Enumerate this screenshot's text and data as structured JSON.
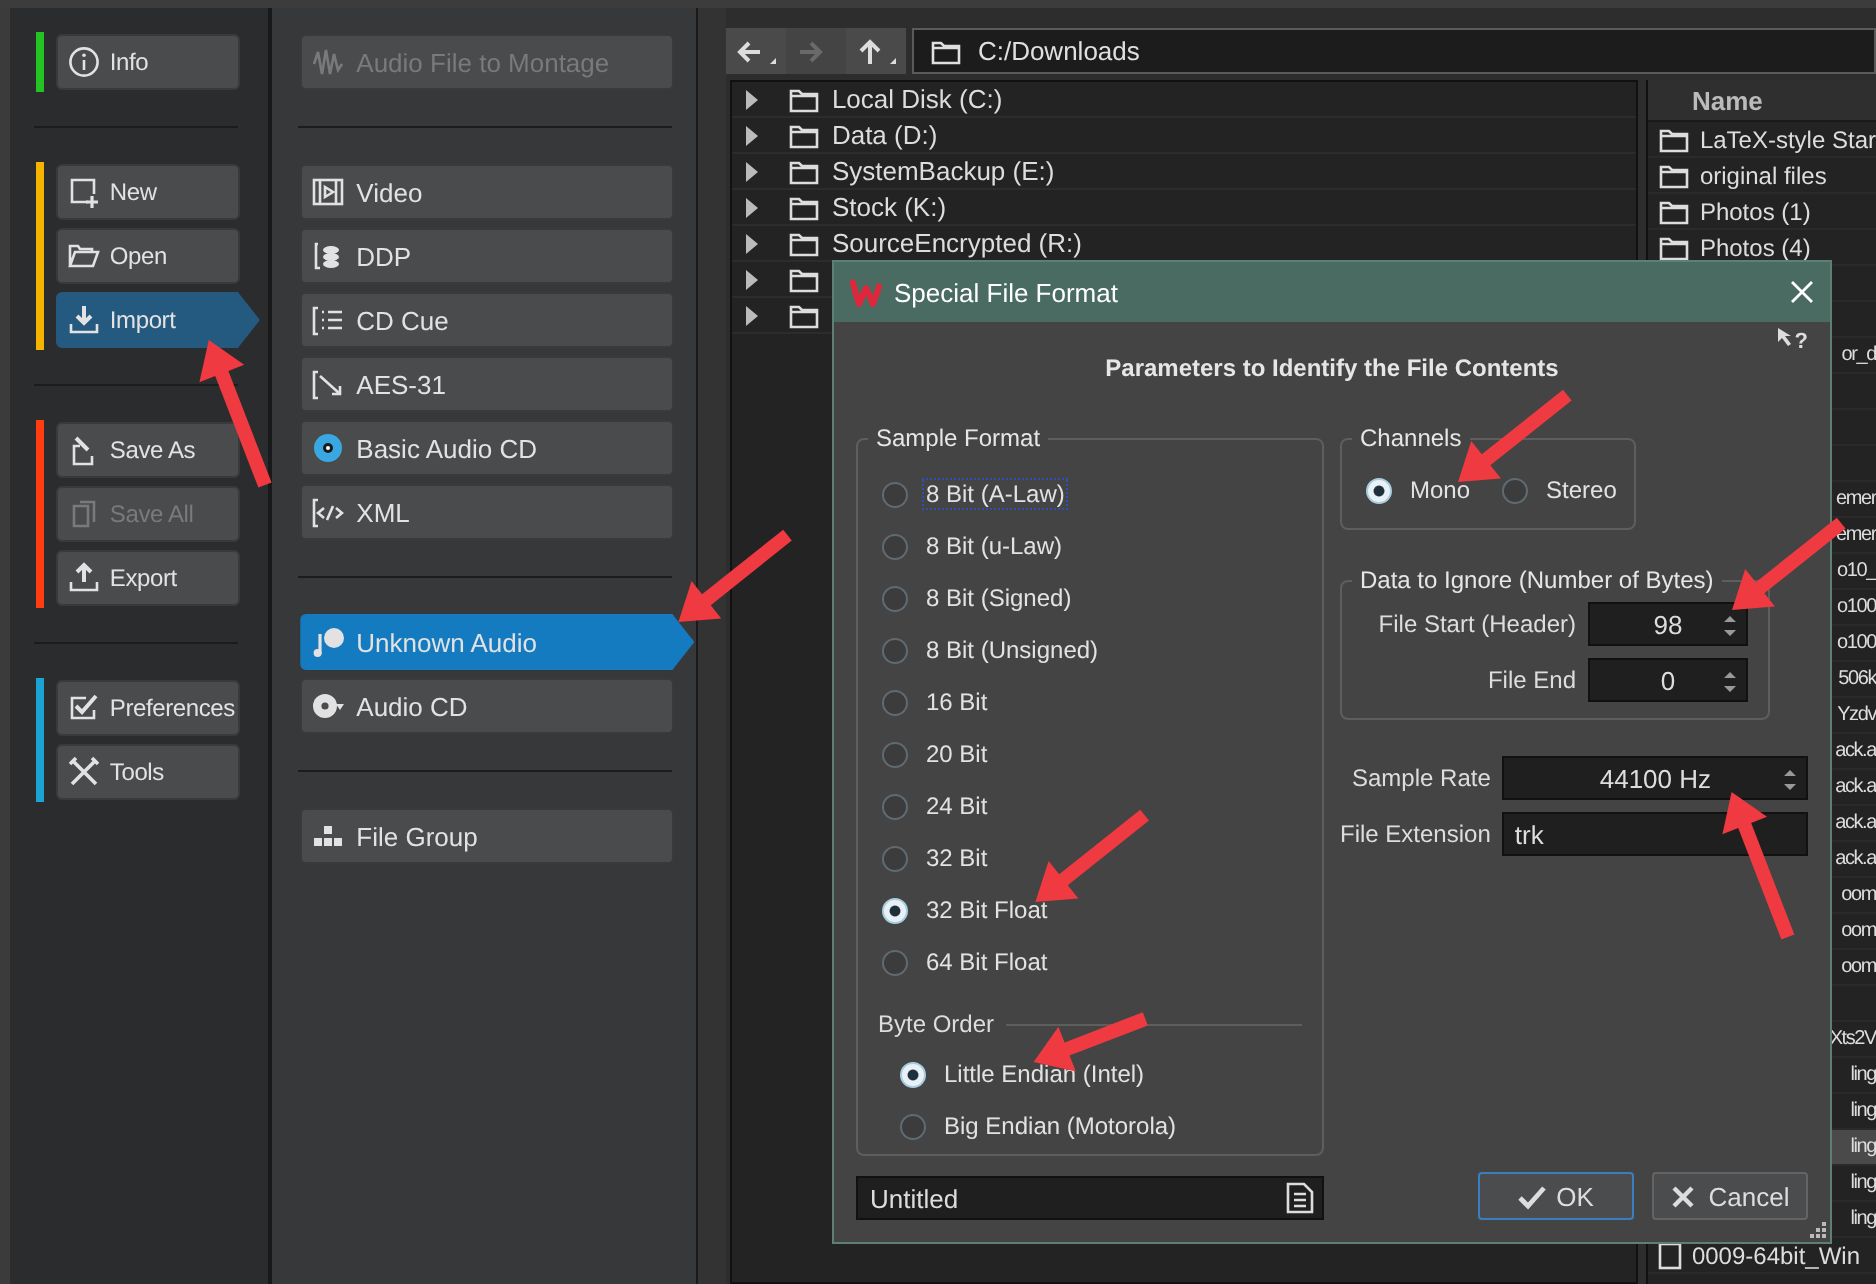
{
  "sidebar": {
    "groups": [
      {
        "color": "#22c322",
        "items": [
          {
            "label": "Info",
            "selected": false,
            "disabled": false
          }
        ]
      },
      {
        "color": "#f5b400",
        "items": [
          {
            "label": "New",
            "selected": false,
            "disabled": false
          },
          {
            "label": "Open",
            "selected": false,
            "disabled": false
          },
          {
            "label": "Import",
            "selected": true,
            "disabled": false
          }
        ]
      },
      {
        "color": "#ff3d10",
        "items": [
          {
            "label": "Save As",
            "selected": false,
            "disabled": false
          },
          {
            "label": "Save All",
            "selected": false,
            "disabled": true
          },
          {
            "label": "Export",
            "selected": false,
            "disabled": false
          }
        ]
      },
      {
        "color": "#1aa3d4",
        "items": [
          {
            "label": "Preferences",
            "selected": false,
            "disabled": false
          },
          {
            "label": "Tools",
            "selected": false,
            "disabled": false
          }
        ]
      }
    ]
  },
  "format_panel": {
    "groups": [
      {
        "items": [
          {
            "label": "Audio File to Montage",
            "selected": false,
            "disabled": true
          }
        ]
      },
      {
        "items": [
          {
            "label": "Video",
            "selected": false,
            "disabled": false
          },
          {
            "label": "DDP",
            "selected": false,
            "disabled": false
          },
          {
            "label": "CD Cue",
            "selected": false,
            "disabled": false
          },
          {
            "label": "AES-31",
            "selected": false,
            "disabled": false
          },
          {
            "label": "Basic Audio CD",
            "selected": false,
            "disabled": false
          },
          {
            "label": "XML",
            "selected": false,
            "disabled": false
          }
        ]
      },
      {
        "items": [
          {
            "label": "Unknown Audio",
            "selected": true,
            "disabled": false
          },
          {
            "label": "Audio CD",
            "selected": false,
            "disabled": false
          }
        ]
      },
      {
        "items": [
          {
            "label": "File Group",
            "selected": false,
            "disabled": false
          }
        ]
      }
    ]
  },
  "browser": {
    "nav_buttons": [
      {
        "kind": "back",
        "disabled": false
      },
      {
        "kind": "forward",
        "disabled": true
      },
      {
        "kind": "up",
        "disabled": false
      }
    ],
    "path": "C:/Downloads",
    "tree": [
      {
        "name": "Local Disk (C:)",
        "expanded": false
      },
      {
        "name": "Data (D:)",
        "expanded": false
      },
      {
        "name": "SystemBackup (E:)",
        "expanded": false
      },
      {
        "name": "Stock (K:)",
        "expanded": false
      },
      {
        "name": "SourceEncrypted (R:)",
        "expanded": false
      },
      {
        "expanded": false
      },
      {
        "expanded": false
      }
    ],
    "file_list": {
      "columns": [
        "Name"
      ],
      "rows": [
        {
          "name": "LaTeX-style Star",
          "kind": "folder",
          "selected": false
        },
        {
          "name": "original files",
          "kind": "folder",
          "selected": false
        },
        {
          "name": "Photos (1)",
          "kind": "folder",
          "selected": false
        },
        {
          "name": "Photos (4)",
          "kind": "folder",
          "selected": false
        },
        {
          "kind": "blank",
          "selected": false
        },
        {
          "kind": "blank",
          "selected": false
        },
        {
          "name": "or_d",
          "kind": "clipped",
          "selected": false
        },
        {
          "kind": "blank",
          "selected": false
        },
        {
          "kind": "blank",
          "selected": false
        },
        {
          "kind": "blank",
          "selected": false
        },
        {
          "name": "emer",
          "kind": "clipped",
          "selected": false
        },
        {
          "name": "emer",
          "kind": "clipped",
          "selected": false
        },
        {
          "name": "o10_",
          "kind": "clipped",
          "selected": false
        },
        {
          "name": "o100",
          "kind": "clipped",
          "selected": false
        },
        {
          "name": "o100",
          "kind": "clipped",
          "selected": false
        },
        {
          "name": "506k",
          "kind": "clipped",
          "selected": false
        },
        {
          "name": "Yzdv",
          "kind": "clipped",
          "selected": false
        },
        {
          "name": "ack.a",
          "kind": "clipped",
          "selected": false
        },
        {
          "name": "ack.a",
          "kind": "clipped",
          "selected": false
        },
        {
          "name": "ack.a",
          "kind": "clipped",
          "selected": false
        },
        {
          "name": "ack.a",
          "kind": "clipped",
          "selected": false
        },
        {
          "name": "oom",
          "kind": "clipped",
          "selected": false
        },
        {
          "name": "oom",
          "kind": "clipped",
          "selected": false
        },
        {
          "name": "oom",
          "kind": "clipped",
          "selected": false
        },
        {
          "kind": "blank",
          "selected": false
        },
        {
          "name": "Xts2V",
          "kind": "clipped",
          "selected": false
        },
        {
          "name": "ling",
          "kind": "clipped",
          "selected": false
        },
        {
          "name": "ling",
          "kind": "clipped",
          "selected": false
        },
        {
          "name": "ling",
          "kind": "clipped",
          "selected": true
        },
        {
          "name": "ling",
          "kind": "clipped",
          "selected": false
        },
        {
          "name": "ling",
          "kind": "clipped",
          "selected": false
        },
        {
          "name": "0009-64bit_Win",
          "kind": "file",
          "selected": false
        }
      ]
    }
  },
  "dialog": {
    "title": "Special File Format",
    "help_label": "?",
    "heading": "Parameters to Identify the File Contents",
    "sample_format": {
      "title": "Sample Format",
      "options": [
        {
          "label": "8 Bit (A-Law)",
          "selected": false,
          "focused": true
        },
        {
          "label": "8 Bit (u-Law)",
          "selected": false,
          "focused": false
        },
        {
          "label": "8 Bit (Signed)",
          "selected": false,
          "focused": false
        },
        {
          "label": "8 Bit (Unsigned)",
          "selected": false,
          "focused": false
        },
        {
          "label": "16 Bit",
          "selected": false,
          "focused": false
        },
        {
          "label": "20 Bit",
          "selected": false,
          "focused": false
        },
        {
          "label": "24 Bit",
          "selected": false,
          "focused": false
        },
        {
          "label": "32 Bit",
          "selected": false,
          "focused": false
        },
        {
          "label": "32 Bit Float",
          "selected": true,
          "focused": false
        },
        {
          "label": "64 Bit Float",
          "selected": false,
          "focused": false
        }
      ]
    },
    "byte_order": {
      "title": "Byte Order",
      "options": [
        {
          "label": "Little Endian (Intel)",
          "selected": true
        },
        {
          "label": "Big Endian (Motorola)",
          "selected": false
        }
      ]
    },
    "preset": {
      "value": "Untitled"
    },
    "channels": {
      "title": "Channels",
      "options": [
        {
          "label": "Mono",
          "selected": true
        },
        {
          "label": "Stereo",
          "selected": false
        }
      ]
    },
    "data_to_ignore": {
      "title": "Data to Ignore (Number of Bytes)",
      "fields": [
        {
          "label": "File Start (Header)",
          "value": "98"
        },
        {
          "label": "File End",
          "value": "0"
        }
      ]
    },
    "sample_rate": {
      "label": "Sample Rate",
      "value": "44100 Hz"
    },
    "file_extension": {
      "label": "File Extension",
      "value": "trk"
    },
    "buttons": [
      {
        "label": "OK",
        "kind": "ok",
        "default": true
      },
      {
        "label": "Cancel",
        "kind": "cancel",
        "default": false
      }
    ]
  },
  "annotations": [
    {
      "kind": "arrow"
    },
    {
      "kind": "arrow"
    },
    {
      "kind": "arrow"
    },
    {
      "kind": "arrow"
    },
    {
      "kind": "arrow"
    },
    {
      "kind": "arrow"
    },
    {
      "kind": "arrow"
    }
  ]
}
